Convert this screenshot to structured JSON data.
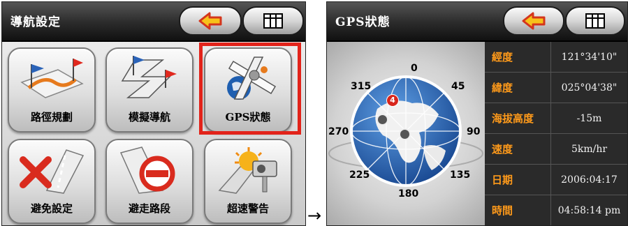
{
  "nav_settings": {
    "title": "導航設定",
    "back_icon": "back-arrow-icon",
    "grid_icon": "grid-icon",
    "menu": [
      {
        "label": "路徑規劃",
        "icon": "route-planning-icon"
      },
      {
        "label": "模擬導航",
        "icon": "simulation-navigation-icon"
      },
      {
        "label": "GPS狀態",
        "icon": "gps-satellite-icon",
        "highlighted": true
      },
      {
        "label": "避免設定",
        "icon": "avoid-settings-icon"
      },
      {
        "label": "避走路段",
        "icon": "avoid-road-icon"
      },
      {
        "label": "超速警告",
        "icon": "speed-camera-icon"
      }
    ]
  },
  "transition_arrow": "→",
  "gps_status": {
    "title": "GPS狀態",
    "compass": {
      "n": "0",
      "ne": "45",
      "e": "90",
      "se": "135",
      "s": "180",
      "sw": "225",
      "w": "270",
      "nw": "315"
    },
    "satellites": [
      {
        "id": "4",
        "active": true
      },
      {
        "id": "",
        "active": false
      },
      {
        "id": "",
        "active": false
      }
    ],
    "fields": [
      {
        "label": "經度",
        "value": "121°34'10\""
      },
      {
        "label": "緯度",
        "value": "025°04'38\""
      },
      {
        "label": "海拔高度",
        "value": "-15m"
      },
      {
        "label": "速度",
        "value": "5km/hr"
      },
      {
        "label": "日期",
        "value": "2006:04:17"
      },
      {
        "label": "時間",
        "value": "04:58:14 pm"
      }
    ]
  },
  "colors": {
    "highlight": "#e2231a",
    "label_orange": "#ff9a1a",
    "globe_blue": "#1f5fb0"
  }
}
